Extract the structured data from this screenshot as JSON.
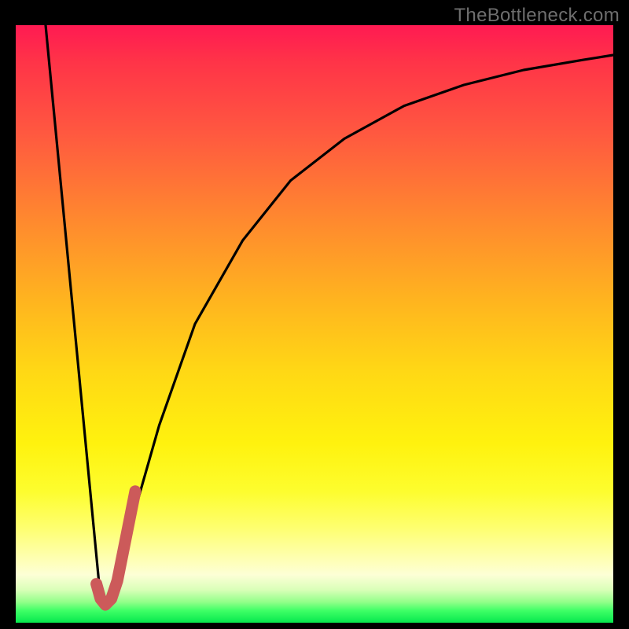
{
  "watermark": "TheBottleneck.com",
  "colors": {
    "gradient_top": "#ff1a52",
    "gradient_mid": "#ffd815",
    "gradient_bottom": "#06e84e",
    "curve": "#000000",
    "accent_segment": "#cc5a5a",
    "frame": "#000000"
  },
  "chart_data": {
    "type": "line",
    "title": "",
    "xlabel": "",
    "ylabel": "",
    "xlim": [
      0,
      100
    ],
    "ylim": [
      0,
      100
    ],
    "grid": false,
    "series": [
      {
        "name": "bottleneck-curve",
        "x": [
          5,
          14,
          15,
          16,
          18,
          20,
          24,
          30,
          38,
          46,
          55,
          65,
          75,
          85,
          95,
          100
        ],
        "y": [
          100,
          6,
          3,
          4,
          10,
          19,
          33,
          50,
          64,
          74,
          81,
          86.5,
          90,
          92.5,
          94.2,
          95
        ]
      }
    ],
    "annotations": [
      {
        "name": "accent-j-segment",
        "x": [
          13.5,
          14.2,
          15,
          16,
          17,
          18,
          19,
          20
        ],
        "y": [
          6.5,
          4.0,
          3.0,
          4.0,
          7.0,
          12.0,
          17.0,
          22.0
        ]
      }
    ]
  }
}
